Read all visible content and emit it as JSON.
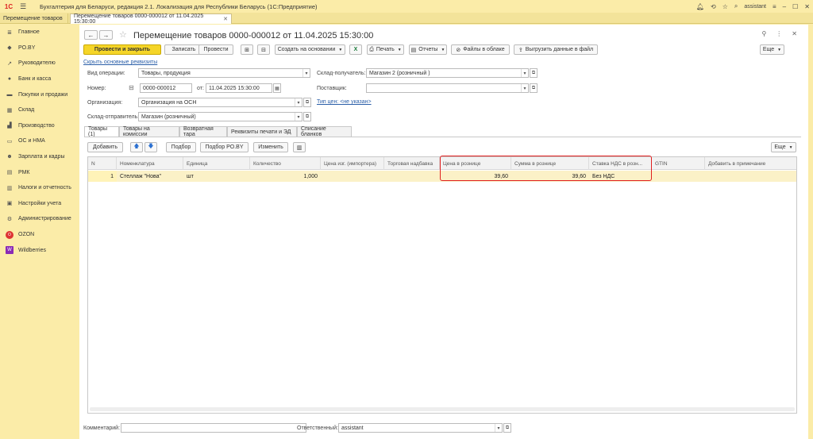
{
  "app": {
    "logo": "1С",
    "title": "Бухгалтерия для Беларуси, редакция 2.1. Локализация для Республики Беларусь   (1С:Предприятие)",
    "user": "assistant"
  },
  "window_tabs": [
    {
      "label": "Перемещение товаров"
    },
    {
      "label": "Перемещение товаров 0000-000012 от 11.04.2025 15:30:00"
    }
  ],
  "sidebar": {
    "items": [
      {
        "label": "Главное",
        "icon": "menu-icon"
      },
      {
        "label": "PO.BY",
        "icon": "po-icon"
      },
      {
        "label": "Руководителю",
        "icon": "chart-icon"
      },
      {
        "label": "Банк и касса",
        "icon": "bank-icon"
      },
      {
        "label": "Покупки и продажи",
        "icon": "cart-icon"
      },
      {
        "label": "Склад",
        "icon": "warehouse-icon"
      },
      {
        "label": "Производство",
        "icon": "factory-icon"
      },
      {
        "label": "ОС и НМА",
        "icon": "car-icon"
      },
      {
        "label": "Зарплата и кадры",
        "icon": "people-icon"
      },
      {
        "label": "РМК",
        "icon": "cashier-icon"
      },
      {
        "label": "Налоги и отчетность",
        "icon": "tax-icon"
      },
      {
        "label": "Настройки учета",
        "icon": "settings-icon"
      },
      {
        "label": "Администрирование",
        "icon": "gear-icon"
      },
      {
        "label": "OZON",
        "icon": "ozon-icon"
      },
      {
        "label": "Wildberries",
        "icon": "wb-icon"
      }
    ]
  },
  "document": {
    "title": "Перемещение товаров 0000-000012 от 11.04.2025 15:30:00"
  },
  "toolbar": {
    "post_close": "Провести и закрыть",
    "save": "Записать",
    "post": "Провести",
    "create_based": "Создать на основании",
    "print": "Печать",
    "reports": "Отчеты",
    "cloud_files": "Файлы в облаке",
    "export": "Выгрузить данные в файл",
    "more": "Еще"
  },
  "form": {
    "hide_link": "Скрыть основные реквизиты",
    "op_type_label": "Вид операции:",
    "op_type_value": "Товары, продукция",
    "number_label": "Номер:",
    "number_value": "0000-000012",
    "date_from_label": "от:",
    "date_value": "11.04.2025 15:30:00",
    "org_label": "Организация:",
    "org_value": "Организация на ОСН",
    "sender_label": "Склад-отправитель:",
    "sender_value": "Магазин (розничный)",
    "receiver_label": "Склад-получатель:",
    "receiver_value": "Магазин 2 (розничный )",
    "supplier_label": "Поставщик:",
    "supplier_value": "",
    "price_type_link": "Тип цен: <не указан>"
  },
  "section_tabs": [
    {
      "label": "Товары (1)"
    },
    {
      "label": "Товары на комиссии"
    },
    {
      "label": "Возвратная тара"
    },
    {
      "label": "Реквизиты печати и ЭД"
    },
    {
      "label": "Списание бланков"
    }
  ],
  "grid_toolbar": {
    "add": "Добавить",
    "select": "Подбор",
    "select_po": "Подбор PO.BY",
    "change": "Изменить",
    "more": "Еще"
  },
  "table": {
    "columns": [
      "N",
      "Номенклатура",
      "Единица",
      "Количество",
      "Цена изг. (импортера)",
      "Торговая надбавка",
      "Цена в рознице",
      "Сумма в рознице",
      "Ставка НДС в розн...",
      "GTIN",
      "Добавить в примечание"
    ],
    "rows": [
      {
        "n": "1",
        "item": "Стеллаж \"Нова\"",
        "unit": "шт",
        "qty": "1,000",
        "mfr_price": "",
        "markup": "",
        "retail_price": "39,60",
        "retail_sum": "39,60",
        "vat": "Без НДС",
        "gtin": "",
        "note": ""
      }
    ]
  },
  "footer": {
    "comment_label": "Комментарий:",
    "comment_value": "",
    "responsible_label": "Ответственный:",
    "responsible_value": "assistant"
  },
  "colors": {
    "accent": "#f5d528",
    "sidebar_bg": "#fbeca8",
    "highlight": "#e02020",
    "link": "#2a5ea8"
  }
}
